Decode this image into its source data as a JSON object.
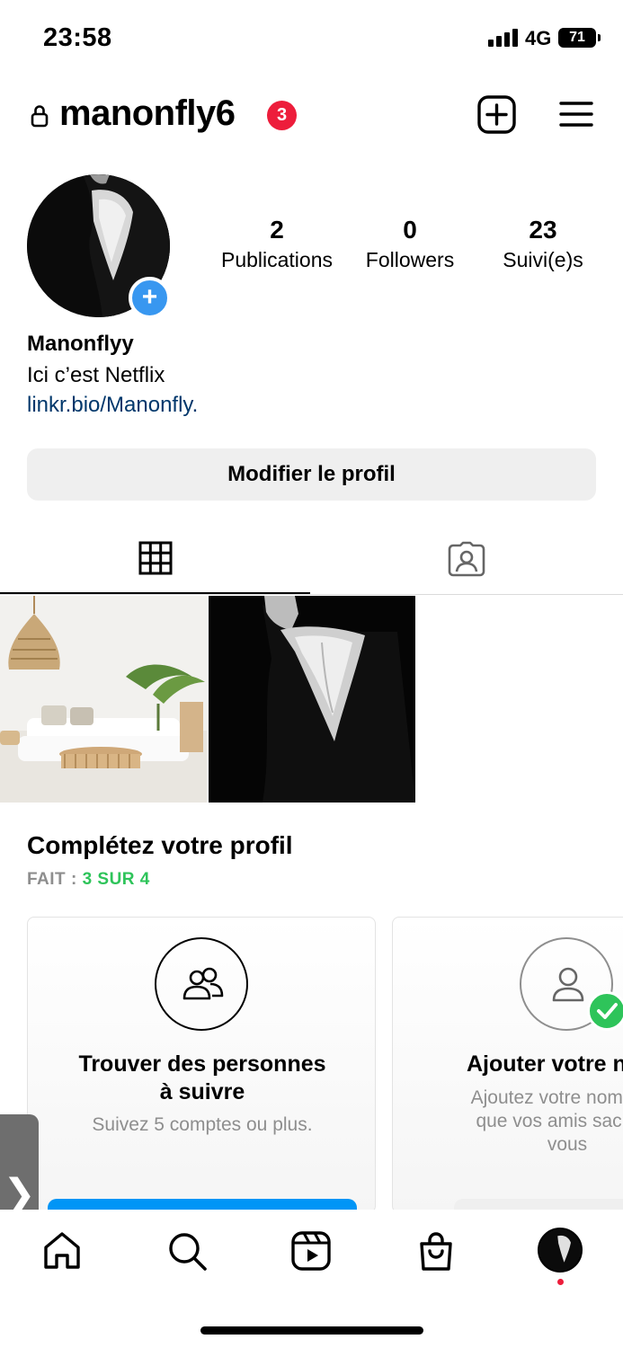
{
  "status_bar": {
    "time": "23:58",
    "network": "4G",
    "battery": "71"
  },
  "header": {
    "username": "manonfly6",
    "notification_count": "3",
    "icons": [
      "lock-icon",
      "create-post-icon",
      "menu-icon"
    ]
  },
  "profile": {
    "stats": [
      {
        "value": "2",
        "label": "Publications"
      },
      {
        "value": "0",
        "label": "Followers"
      },
      {
        "value": "23",
        "label": "Suivi(e)s"
      }
    ],
    "display_name": "Manonflyy",
    "bio": "Ici c’est Netflix",
    "link": "linkr.bio/Manonfly.",
    "edit_button": "Modifier le profil",
    "add_story_glyph": "+"
  },
  "tabs": {
    "icons": [
      "grid-icon",
      "tagged-icon"
    ],
    "active": "grid"
  },
  "posts": [
    "interior-photo",
    "portrait-photo"
  ],
  "complete_profile": {
    "title": "Complétez votre profil",
    "progress_label": "FAIT : ",
    "progress_value": "3 SUR 4",
    "cards": [
      {
        "title_line1": "Trouver des personnes",
        "title_line2": "à suivre",
        "subtitle": "Suivez 5 comptes ou plus.",
        "icon": "people-icon"
      },
      {
        "title": "Ajouter votre n",
        "subtitle_line1": "Ajoutez votre nom com",
        "subtitle_line2": "que vos amis sachent",
        "subtitle_line3": "vous",
        "icon": "person-icon"
      }
    ]
  },
  "side_handle": "❯",
  "bottom_nav": {
    "items": [
      "home-icon",
      "search-icon",
      "reels-icon",
      "shop-icon",
      "profile-avatar"
    ]
  },
  "colors": {
    "accent_blue": "#0095f6",
    "badge_red": "#ed1d3b",
    "success_green": "#2ec45a",
    "link_blue": "#00376b"
  }
}
